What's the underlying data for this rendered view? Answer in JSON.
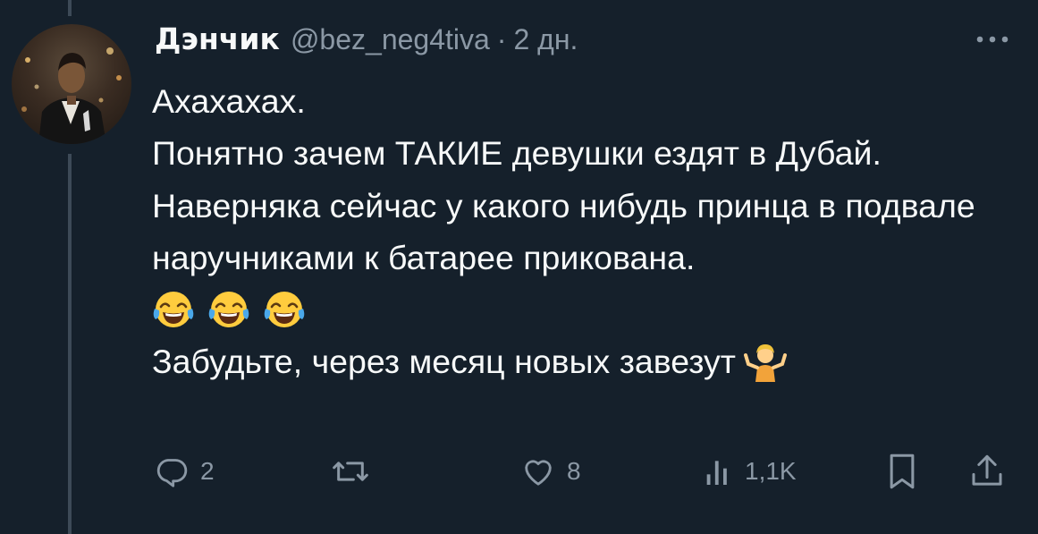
{
  "tweet": {
    "author": {
      "name": "Дэнчик",
      "handle": "@bez_neg4tiva",
      "separator": "·",
      "time": "2 дн."
    },
    "body": {
      "line1": "Ахахахах.",
      "line2": "Понятно зачем ТАКИЕ девушки ездят в Дубай.",
      "line3": "Наверняка сейчас у какого нибудь принца в подвале наручниками к батарее прикована.",
      "emojis": [
        "face-with-tears-of-joy",
        "face-with-tears-of-joy",
        "face-with-tears-of-joy"
      ],
      "line4": "Забудьте, через месяц новых завезут",
      "line4_emoji": "person-shrugging"
    },
    "actions": {
      "reply_count": "2",
      "retweet_count": "",
      "like_count": "8",
      "views_count": "1,1K"
    }
  },
  "colors": {
    "background": "#15202b",
    "text": "#f7f9f9",
    "secondary": "#8b98a5",
    "thread_line": "#3d4a57"
  }
}
